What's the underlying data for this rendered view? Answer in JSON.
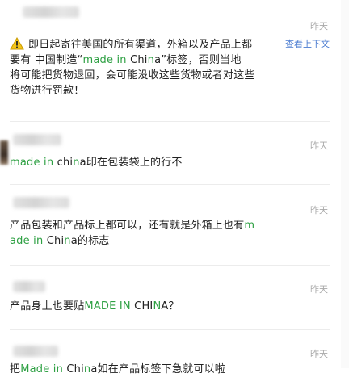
{
  "messages": [
    {
      "time": "昨天",
      "side_link": "查看上下文",
      "lines": [
        [
          "即日起寄往美国的所有渠道，外箱以及产品上都"
        ],
        [
          "要有 中国制造“",
          {
            "hl": "made in"
          },
          " Chi",
          {
            "hl": "n"
          },
          "a”标签，否则当地"
        ],
        [
          "将可能把货物退回，会可能没收这些货物或者对这些"
        ],
        [
          "货物进行罚款！"
        ]
      ]
    },
    {
      "time": "昨天",
      "lines": [
        [
          {
            "hl": "made in"
          },
          " chi",
          {
            "hl": "n"
          },
          "a印在包装袋上的行不"
        ]
      ]
    },
    {
      "time": "昨天",
      "lines": [
        [
          "产品包装和产品标上都可以，还有就是外箱上也有",
          {
            "hl": "m"
          }
        ],
        [
          {
            "hl": "ade in"
          },
          " Chi",
          {
            "hl": "n"
          },
          "a的标志"
        ]
      ]
    },
    {
      "time": "昨天",
      "lines": [
        [
          "产品身上也要贴",
          {
            "hl": "MADE IN"
          },
          " CHI",
          {
            "hl": "N"
          },
          "A？"
        ]
      ]
    },
    {
      "time": "昨天",
      "lines": [
        [
          "把",
          {
            "hl": "Made in"
          },
          " Chi",
          {
            "hl": "n"
          },
          "a如在产品标签下急就可以啦"
        ]
      ]
    }
  ],
  "icons": {
    "warning": "warning-icon"
  },
  "colors": {
    "highlight": "#2ea043",
    "time": "#a8a8a8",
    "link": "#4a7bd0"
  }
}
